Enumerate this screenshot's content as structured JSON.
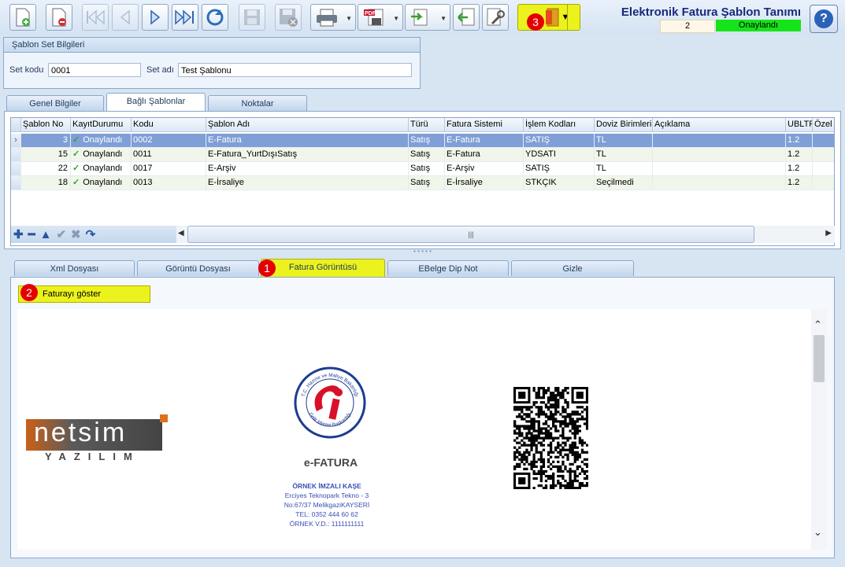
{
  "toolbar": {
    "buttons": [
      {
        "name": "new-record-button",
        "icon": "new-document-icon"
      },
      {
        "name": "delete-record-button",
        "icon": "delete-document-icon"
      },
      {
        "name": "first-record-button",
        "icon": "first-icon"
      },
      {
        "name": "previous-record-button",
        "icon": "previous-icon"
      },
      {
        "name": "next-record-button",
        "icon": "next-icon"
      },
      {
        "name": "last-record-button",
        "icon": "last-icon"
      },
      {
        "name": "refresh-button",
        "icon": "refresh-icon"
      },
      {
        "name": "save-button",
        "icon": "save-icon"
      },
      {
        "name": "cancel-save-button",
        "icon": "save-cancel-icon"
      },
      {
        "name": "print-button",
        "icon": "printer-icon"
      },
      {
        "name": "pdf-export-button",
        "icon": "pdf-icon"
      },
      {
        "name": "import-button",
        "icon": "import-icon"
      },
      {
        "name": "exit-button",
        "icon": "exit-icon"
      },
      {
        "name": "tools-button",
        "icon": "wrench-icon"
      },
      {
        "name": "door-menu-button",
        "icon": "door-icon"
      }
    ],
    "badge3": "3"
  },
  "header": {
    "title": "Elektronik Fatura Şablon Tanımı",
    "record_count": "2",
    "status": "Onaylandı",
    "status_color": "#16e41a"
  },
  "set_info": {
    "group_title": "Şablon Set Bilgileri",
    "set_kodu_label": "Set kodu",
    "set_kodu_value": "0001",
    "set_adi_label": "Set adı",
    "set_adi_value": "Test Şablonu"
  },
  "main_tabs": [
    "Genel Bilgiler",
    "Bağlı Şablonlar",
    "Noktalar"
  ],
  "grid": {
    "columns": [
      "Şablon No",
      "KayıtDurumu",
      "Kodu",
      "Şablon Adı",
      "Türü",
      "Fatura Sistemi",
      "İşlem Kodları",
      "Doviz Birimleri",
      "Açıklama",
      "UBLTR",
      "Özel F"
    ],
    "rows": [
      {
        "no": "3",
        "durum": "Onaylandı",
        "kodu": "0002",
        "adi": "E-Fatura",
        "turu": "Satış",
        "sistem": "E-Fatura",
        "islem": "SATIŞ",
        "doviz": "TL",
        "aciklama": "",
        "ubl": "1.2"
      },
      {
        "no": "15",
        "durum": "Onaylandı",
        "kodu": "0011",
        "adi": "E-Fatura_YurtDışıSatış",
        "turu": "Satış",
        "sistem": "E-Fatura",
        "islem": "YDSATI",
        "doviz": "TL",
        "aciklama": "",
        "ubl": "1.2"
      },
      {
        "no": "22",
        "durum": "Onaylandı",
        "kodu": "0017",
        "adi": "E-Arşiv",
        "turu": "Satış",
        "sistem": "E-Arşiv",
        "islem": "SATIŞ",
        "doviz": "TL",
        "aciklama": "",
        "ubl": "1.2"
      },
      {
        "no": "18",
        "durum": "Onaylandı",
        "kodu": "0013",
        "adi": "E-İrsaliye",
        "turu": "Satış",
        "sistem": "E-İrsaliye",
        "islem": "STKÇIK",
        "doviz": "Seçilmedi",
        "aciklama": "",
        "ubl": "1.2"
      }
    ],
    "scroll_grip": "|||"
  },
  "lower_tabs": [
    "Xml Dosyası",
    "Görüntü Dosyası",
    "Fatura Görüntüsü",
    "EBelge Dip Not",
    "Gizle"
  ],
  "badge1": "1",
  "badge2": "2",
  "show_invoice_button": "Faturayı göster",
  "invoice": {
    "logo_text": "netsim",
    "logo_sub": "YAZILIM",
    "seal_top": "T.C. Hazine ve Maliye Bakanlığı",
    "seal_bottom": "Gelir İdaresi Başkanlığı",
    "type": "e-FATURA",
    "kase_title": "ÖRNEK İMZALI KAŞE",
    "kase_lines": [
      "Erciyes Teknopark Tekno - 3",
      "No:67/37 MelikgaziKAYSERİ",
      "TEL: 0352 444 60 62",
      "ÖRNEK V.D.: 1111111111"
    ]
  }
}
